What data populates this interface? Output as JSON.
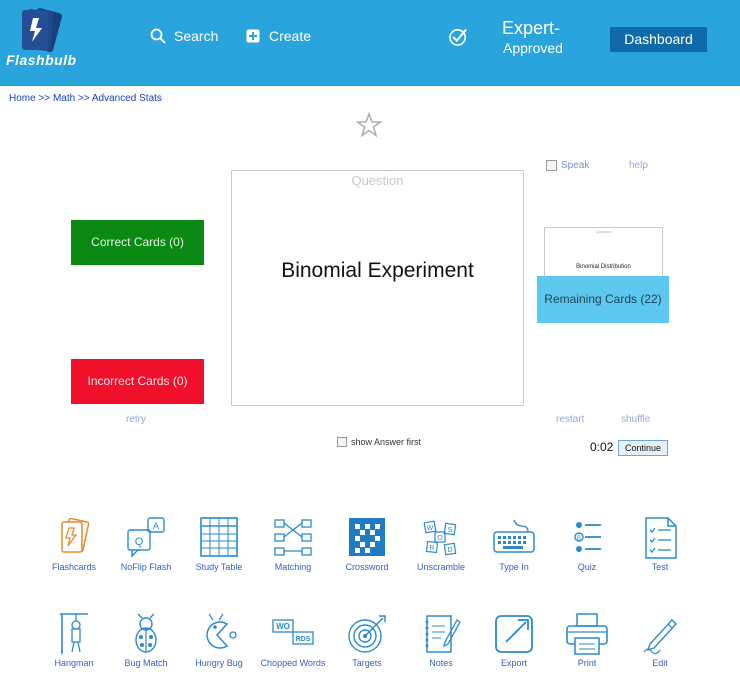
{
  "header": {
    "logo_text": "Flashbulb",
    "nav": [
      {
        "label": "Search",
        "icon": "search-icon"
      },
      {
        "label": "Create",
        "icon": "create-icon"
      }
    ],
    "badge_line1": "Expert-",
    "badge_line2": "Approved",
    "dashboard_label": "Dashboard"
  },
  "breadcrumb": {
    "items": [
      "Home",
      "Math",
      "Advanced Stats"
    ],
    "separator": ">>"
  },
  "controls": {
    "speak_label": "Speak",
    "help_label": "help",
    "retry_label": "retry",
    "restart_label": "restart",
    "shuffle_label": "shuffle",
    "show_answer_label": "show Answer first",
    "timer": "0:02",
    "continue_label": "Continue"
  },
  "card": {
    "side_label": "Question",
    "term": "Binomial Experiment"
  },
  "next_card": {
    "side_label": "Question",
    "term": "Binomial Distribution"
  },
  "scores": {
    "correct_label": "Correct Cards (0)",
    "incorrect_label": "Incorrect Cards (0)",
    "remaining_label": "Remaining Cards (22)"
  },
  "tools": [
    {
      "label": "Flashcards",
      "icon": "flashcards-icon"
    },
    {
      "label": "NoFlip Flash",
      "icon": "noflip-icon"
    },
    {
      "label": "Study Table",
      "icon": "table-icon"
    },
    {
      "label": "Matching",
      "icon": "matching-icon"
    },
    {
      "label": "Crossword",
      "icon": "crossword-icon"
    },
    {
      "label": "Unscramble",
      "icon": "unscramble-icon"
    },
    {
      "label": "Type In",
      "icon": "keyboard-icon"
    },
    {
      "label": "Quiz",
      "icon": "quiz-icon"
    },
    {
      "label": "Test",
      "icon": "test-icon"
    },
    {
      "label": "Hangman",
      "icon": "hangman-icon"
    },
    {
      "label": "Bug Match",
      "icon": "bug-icon"
    },
    {
      "label": "Hungry Bug",
      "icon": "hungry-bug-icon"
    },
    {
      "label": "Chopped Words",
      "icon": "chopped-words-icon"
    },
    {
      "label": "Targets",
      "icon": "target-icon"
    },
    {
      "label": "Notes",
      "icon": "notes-icon"
    },
    {
      "label": "Export",
      "icon": "export-icon"
    },
    {
      "label": "Print",
      "icon": "printer-icon"
    },
    {
      "label": "Edit",
      "icon": "pen-icon"
    }
  ],
  "colors": {
    "header": "#2aa4dd",
    "correct": "#0a8a12",
    "incorrect": "#f0102c",
    "remaining": "#5dc8ef",
    "dashboard": "#116aa8"
  }
}
